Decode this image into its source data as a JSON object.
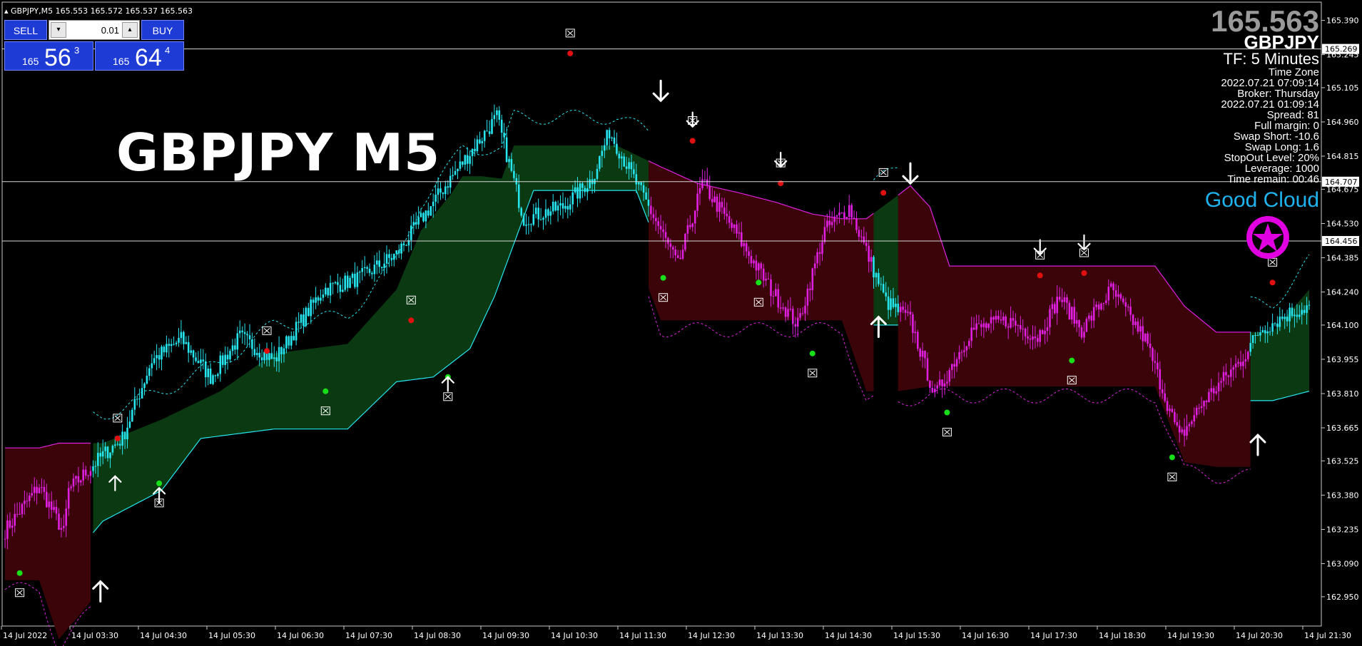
{
  "header": {
    "symbol_tf": "GBPJPY,M5",
    "ohlc": "165.553 165.572 165.537 165.563"
  },
  "trade_panel": {
    "sell_label": "SELL",
    "buy_label": "BUY",
    "lot_value": "0.01",
    "bid": {
      "prefix": "165",
      "big": "56",
      "sup": "3"
    },
    "ask": {
      "prefix": "165",
      "big": "64",
      "sup": "4"
    }
  },
  "overlay_title": "GBPJPY M5",
  "info": {
    "price": "165.563",
    "symbol": "GBPJPY",
    "timeframe": "TF: 5 Minutes",
    "rows": [
      "Time Zone",
      "2022.07.21 07:09:14",
      "Broker: Thursday",
      "2022.07.21 01:09:14",
      "Spread:    81",
      "Full margin:     0",
      "Swap Short:  -10.6",
      "Swap Long:    1.6",
      "StopOut Level:  20%",
      "Leverage:   1000",
      "Time remain: 00:46"
    ],
    "status": "Good Cloud"
  },
  "colors": {
    "bull": "#26e6f0",
    "bear": "#e020e0",
    "bull_cloud": "#0b3a12",
    "bear_cloud": "#3a0408",
    "up_dot": "#18e018",
    "down_dot": "#e01010"
  },
  "chart_data": {
    "type": "candlestick",
    "ylim": [
      162.85,
      165.44
    ],
    "y_ticks": [
      "165.390",
      "165.245",
      "165.105",
      "164.960",
      "164.815",
      "164.675",
      "164.530",
      "164.385",
      "164.240",
      "164.100",
      "163.955",
      "163.810",
      "163.665",
      "163.525",
      "163.380",
      "163.235",
      "163.090",
      "162.950"
    ],
    "price_tags": [
      "165.269",
      "164.707",
      "164.456"
    ],
    "x_labels": [
      "14 Jul 2022",
      "14 Jul 03:30",
      "14 Jul 04:30",
      "14 Jul 05:30",
      "14 Jul 06:30",
      "14 Jul 07:30",
      "14 Jul 08:30",
      "14 Jul 09:30",
      "14 Jul 10:30",
      "14 Jul 11:30",
      "14 Jul 12:30",
      "14 Jul 13:30",
      "14 Jul 14:30",
      "14 Jul 15:30",
      "14 Jul 16:30",
      "14 Jul 17:30",
      "14 Jul 18:30",
      "14 Jul 19:30",
      "14 Jul 20:30",
      "14 Jul 21:30"
    ],
    "close_anchors": [
      [
        0,
        163.23
      ],
      [
        14,
        163.42
      ],
      [
        24,
        163.22
      ],
      [
        26,
        163.4
      ],
      [
        40,
        163.55
      ],
      [
        48,
        163.62
      ],
      [
        60,
        163.95
      ],
      [
        72,
        164.04
      ],
      [
        84,
        163.88
      ],
      [
        96,
        164.05
      ],
      [
        110,
        163.95
      ],
      [
        130,
        164.25
      ],
      [
        145,
        164.3
      ],
      [
        160,
        164.4
      ],
      [
        182,
        164.72
      ],
      [
        201,
        164.98
      ],
      [
        212,
        164.55
      ],
      [
        228,
        164.6
      ],
      [
        240,
        164.72
      ],
      [
        247,
        164.92
      ],
      [
        258,
        164.7
      ],
      [
        268,
        164.5
      ],
      [
        275,
        164.35
      ],
      [
        285,
        164.7
      ],
      [
        298,
        164.5
      ],
      [
        313,
        164.25
      ],
      [
        324,
        164.1
      ],
      [
        335,
        164.5
      ],
      [
        345,
        164.6
      ],
      [
        360,
        164.2
      ],
      [
        370,
        164.12
      ],
      [
        380,
        163.8
      ],
      [
        395,
        164.08
      ],
      [
        410,
        164.12
      ],
      [
        422,
        164.05
      ],
      [
        431,
        164.22
      ],
      [
        440,
        164.08
      ],
      [
        452,
        164.25
      ],
      [
        466,
        164.04
      ],
      [
        480,
        163.62
      ],
      [
        490,
        163.78
      ],
      [
        505,
        163.95
      ],
      [
        513,
        164.08
      ],
      [
        525,
        164.15
      ],
      [
        533,
        164.18
      ]
    ],
    "cloud_top": [
      [
        0,
        163.58
      ],
      [
        14,
        163.58
      ],
      [
        22,
        163.6
      ],
      [
        40,
        163.6
      ],
      [
        64,
        163.7
      ],
      [
        88,
        163.82
      ],
      [
        110,
        163.98
      ],
      [
        140,
        164.02
      ],
      [
        160,
        164.25
      ],
      [
        170,
        164.5
      ],
      [
        182,
        164.65
      ],
      [
        187,
        164.73
      ],
      [
        195,
        164.73
      ],
      [
        203,
        164.72
      ],
      [
        208,
        164.86
      ],
      [
        222,
        164.86
      ],
      [
        250,
        164.86
      ],
      [
        268,
        164.77
      ],
      [
        283,
        164.7
      ],
      [
        300,
        164.66
      ],
      [
        315,
        164.62
      ],
      [
        330,
        164.57
      ],
      [
        342,
        164.55
      ],
      [
        352,
        164.55
      ],
      [
        365,
        164.65
      ],
      [
        370,
        164.69
      ],
      [
        378,
        164.6
      ],
      [
        386,
        164.35
      ],
      [
        395,
        164.35
      ],
      [
        420,
        164.35
      ],
      [
        450,
        164.35
      ],
      [
        470,
        164.35
      ],
      [
        482,
        164.18
      ],
      [
        495,
        164.07
      ],
      [
        510,
        164.07
      ],
      [
        518,
        164.07
      ],
      [
        533,
        164.25
      ]
    ],
    "cloud_bot": [
      [
        0,
        163.3
      ],
      [
        14,
        163.3
      ],
      [
        22,
        163.05
      ],
      [
        40,
        163.27
      ],
      [
        64,
        163.4
      ],
      [
        80,
        163.62
      ],
      [
        110,
        163.66
      ],
      [
        140,
        163.66
      ],
      [
        160,
        163.86
      ],
      [
        175,
        163.88
      ],
      [
        190,
        164.0
      ],
      [
        200,
        164.22
      ],
      [
        216,
        164.67
      ],
      [
        235,
        164.67
      ],
      [
        258,
        164.67
      ],
      [
        268,
        164.4
      ],
      [
        283,
        164.4
      ],
      [
        300,
        164.4
      ],
      [
        315,
        164.4
      ],
      [
        330,
        164.4
      ],
      [
        342,
        164.4
      ],
      [
        352,
        164.1
      ],
      [
        365,
        164.1
      ],
      [
        378,
        164.12
      ],
      [
        386,
        164.12
      ],
      [
        420,
        164.12
      ],
      [
        450,
        164.12
      ],
      [
        470,
        164.12
      ],
      [
        482,
        163.8
      ],
      [
        495,
        163.78
      ],
      [
        510,
        163.78
      ],
      [
        518,
        163.78
      ],
      [
        533,
        163.82
      ]
    ],
    "bull_zones": [
      [
        0,
        0
      ],
      [
        36,
        263
      ],
      [
        355,
        365
      ],
      [
        509,
        533
      ]
    ],
    "bear_zones": [
      [
        0,
        35
      ],
      [
        263,
        355
      ],
      [
        365,
        509
      ]
    ],
    "dots": [
      {
        "i": 6,
        "price": 163.05,
        "kind": "up"
      },
      {
        "i": 46,
        "price": 163.62,
        "kind": "down"
      },
      {
        "i": 63,
        "price": 163.43,
        "kind": "up"
      },
      {
        "i": 107,
        "price": 163.99,
        "kind": "down"
      },
      {
        "i": 131,
        "price": 163.82,
        "kind": "up"
      },
      {
        "i": 166,
        "price": 164.12,
        "kind": "down"
      },
      {
        "i": 181,
        "price": 163.88,
        "kind": "up"
      },
      {
        "i": 231,
        "price": 165.25,
        "kind": "down"
      },
      {
        "i": 269,
        "price": 164.3,
        "kind": "up"
      },
      {
        "i": 281,
        "price": 164.88,
        "kind": "down"
      },
      {
        "i": 308,
        "price": 164.28,
        "kind": "up"
      },
      {
        "i": 317,
        "price": 164.7,
        "kind": "down"
      },
      {
        "i": 330,
        "price": 163.98,
        "kind": "up"
      },
      {
        "i": 359,
        "price": 164.66,
        "kind": "down"
      },
      {
        "i": 385,
        "price": 163.73,
        "kind": "up"
      },
      {
        "i": 423,
        "price": 164.31,
        "kind": "down"
      },
      {
        "i": 436,
        "price": 163.95,
        "kind": "up"
      },
      {
        "i": 441,
        "price": 164.32,
        "kind": "down"
      },
      {
        "i": 477,
        "price": 163.54,
        "kind": "up"
      },
      {
        "i": 518,
        "price": 164.28,
        "kind": "down"
      }
    ],
    "arrows": [
      {
        "i": 45,
        "price": 163.4,
        "dir": "up",
        "size": "s"
      },
      {
        "i": 63,
        "price": 163.35,
        "dir": "up",
        "size": "s"
      },
      {
        "i": 181,
        "price": 163.82,
        "dir": "up",
        "size": "s"
      },
      {
        "i": 268,
        "price": 165.05,
        "dir": "down",
        "size": "l"
      },
      {
        "i": 281,
        "price": 164.94,
        "dir": "down",
        "size": "s"
      },
      {
        "i": 317,
        "price": 164.77,
        "dir": "down",
        "size": "s"
      },
      {
        "i": 370,
        "price": 164.7,
        "dir": "down",
        "size": "l"
      },
      {
        "i": 357,
        "price": 164.05,
        "dir": "up",
        "size": "l"
      },
      {
        "i": 423,
        "price": 164.4,
        "dir": "down",
        "size": "s"
      },
      {
        "i": 441,
        "price": 164.42,
        "dir": "down",
        "size": "s"
      },
      {
        "i": 39,
        "price": 162.93,
        "dir": "up",
        "size": "l"
      },
      {
        "i": 512,
        "price": 163.55,
        "dir": "up",
        "size": "l"
      }
    ]
  }
}
